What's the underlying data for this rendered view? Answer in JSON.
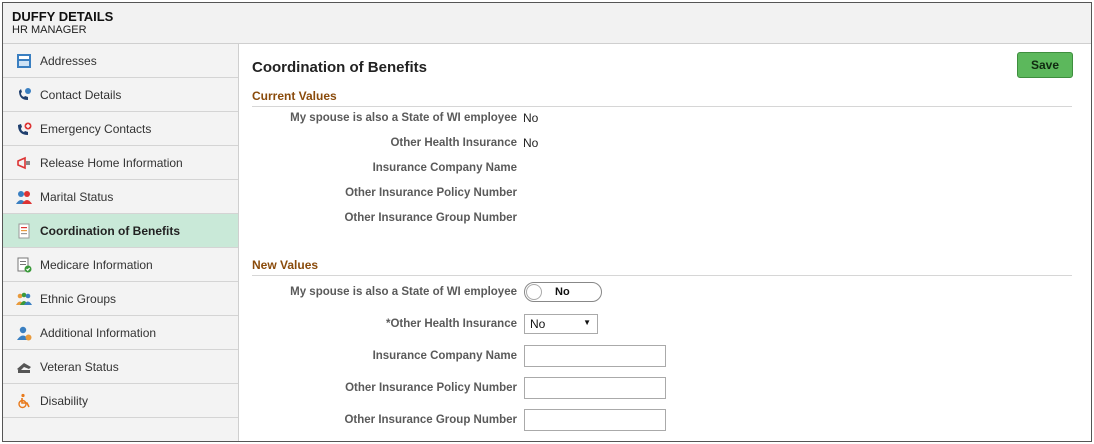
{
  "header": {
    "title": "DUFFY DETAILS",
    "subtitle": "HR MANAGER"
  },
  "sidebar": {
    "items": [
      {
        "label": "Addresses",
        "icon": "address-card-icon"
      },
      {
        "label": "Contact Details",
        "icon": "phone-contact-icon"
      },
      {
        "label": "Emergency Contacts",
        "icon": "emergency-phone-icon"
      },
      {
        "label": "Release Home Information",
        "icon": "megaphone-icon"
      },
      {
        "label": "Marital Status",
        "icon": "couple-icon"
      },
      {
        "label": "Coordination of Benefits",
        "icon": "benefits-document-icon",
        "active": true
      },
      {
        "label": "Medicare Information",
        "icon": "medicare-check-icon"
      },
      {
        "label": "Ethnic Groups",
        "icon": "group-icon"
      },
      {
        "label": "Additional Information",
        "icon": "person-info-icon"
      },
      {
        "label": "Veteran Status",
        "icon": "salute-icon"
      },
      {
        "label": "Disability",
        "icon": "wheelchair-icon"
      }
    ]
  },
  "main": {
    "title": "Coordination of Benefits",
    "save_label": "Save",
    "current": {
      "heading": "Current Values",
      "rows": [
        {
          "label": "My spouse is also a State of WI employee",
          "value": "No"
        },
        {
          "label": "Other Health Insurance",
          "value": "No"
        },
        {
          "label": "Insurance Company Name",
          "value": ""
        },
        {
          "label": "Other Insurance Policy Number",
          "value": ""
        },
        {
          "label": "Other Insurance Group Number",
          "value": ""
        }
      ]
    },
    "new": {
      "heading": "New Values",
      "spouse_label": "My spouse is also a State of WI employee",
      "spouse_toggle": "No",
      "health_label": "*Other Health Insurance",
      "health_selected": "No",
      "company_label": "Insurance Company Name",
      "company_value": "",
      "policy_label": "Other Insurance Policy Number",
      "policy_value": "",
      "group_label": "Other Insurance Group Number",
      "group_value": ""
    }
  },
  "colors": {
    "accent_section": "#8a4b0b",
    "active_nav": "#c9e9d8",
    "save_button": "#5cb85c"
  }
}
